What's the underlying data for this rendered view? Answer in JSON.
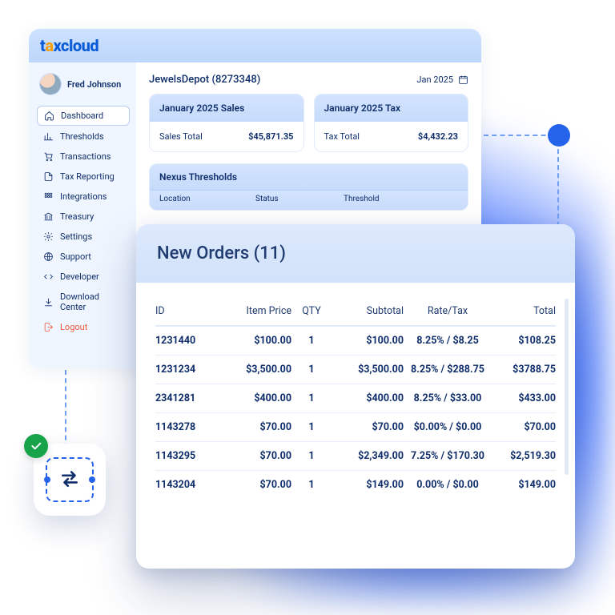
{
  "brand": {
    "part1": "t",
    "accent": "a",
    "part2": "xcloud"
  },
  "user": {
    "name": "Fred Johnson"
  },
  "sidebar": {
    "items": [
      {
        "label": "Dashboard",
        "icon": "home-icon",
        "active": true
      },
      {
        "label": "Thresholds",
        "icon": "chart-icon"
      },
      {
        "label": "Transactions",
        "icon": "cart-icon"
      },
      {
        "label": "Tax Reporting",
        "icon": "report-icon"
      },
      {
        "label": "Integrations",
        "icon": "grid-icon"
      },
      {
        "label": "Treasury",
        "icon": "bank-icon"
      },
      {
        "label": "Settings",
        "icon": "gear-icon"
      },
      {
        "label": "Support",
        "icon": "globe-icon"
      },
      {
        "label": "Developer",
        "icon": "code-icon"
      },
      {
        "label": "Download Center",
        "icon": "download-icon"
      },
      {
        "label": "Logout",
        "icon": "logout-icon",
        "logout": true
      }
    ]
  },
  "main": {
    "merchant": "JewelsDepot (8273348)",
    "period": "Jan 2025",
    "salesCard": {
      "title": "January 2025 Sales",
      "label": "Sales Total",
      "value": "$45,871.35"
    },
    "taxCard": {
      "title": "January 2025 Tax",
      "label": "Tax Total",
      "value": "$4,432.23"
    },
    "nexus": {
      "title": "Nexus Thresholds",
      "cols": [
        "Location",
        "Status",
        "Threshold"
      ]
    }
  },
  "orders": {
    "title": "New Orders (11)",
    "headers": {
      "id": "ID",
      "price": "Item Price",
      "qty": "QTY",
      "sub": "Subtotal",
      "rate": "Rate/Tax",
      "total": "Total"
    },
    "rows": [
      {
        "id": "1231440",
        "price": "$100.00",
        "qty": "1",
        "sub": "$100.00",
        "rate": "8.25% / $8.25",
        "total": "$108.25"
      },
      {
        "id": "1231234",
        "price": "$3,500.00",
        "qty": "1",
        "sub": "$3,500.00",
        "rate": "8.25% / $288.75",
        "total": "$3788.75"
      },
      {
        "id": "2341281",
        "price": "$400.00",
        "qty": "1",
        "sub": "$400.00",
        "rate": "8.25% / $33.00",
        "total": "$433.00"
      },
      {
        "id": "1143278",
        "price": "$70.00",
        "qty": "1",
        "sub": "$70.00",
        "rate": "$0.00% / $0.00",
        "total": "$70.00"
      },
      {
        "id": "1143295",
        "price": "$70.00",
        "qty": "1",
        "sub": "$2,349.00",
        "rate": "7.25% / $170.30",
        "total": "$2,519.30"
      },
      {
        "id": "1143204",
        "price": "$70.00",
        "qty": "1",
        "sub": "$149.00",
        "rate": "0.00% / $0.00",
        "total": "$149.00"
      }
    ]
  }
}
